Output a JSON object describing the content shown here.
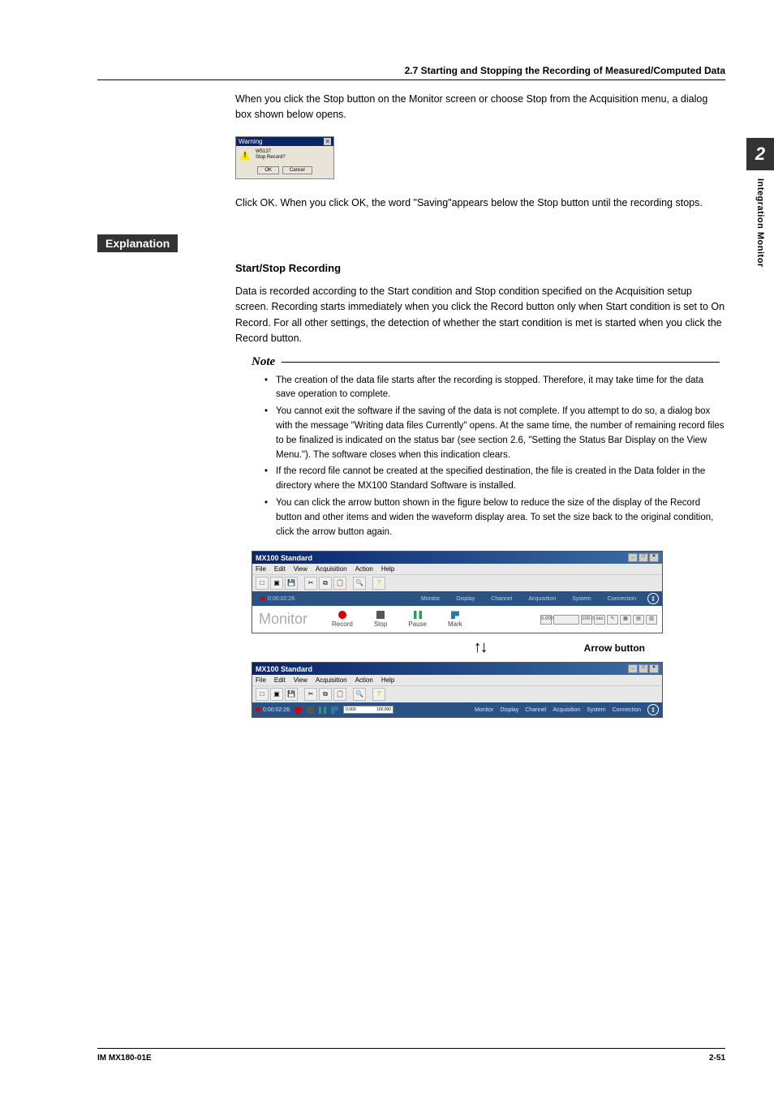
{
  "section_header": "2.7  Starting and Stopping the Recording of Measured/Computed Data",
  "intro_paragraph": "When you click the Stop button on the Monitor screen or choose Stop from the Acquisition menu, a dialog box shown below opens.",
  "warning_dialog": {
    "title": "Warning",
    "code": "W5137",
    "message": "Stop Record?",
    "ok": "OK",
    "cancel": "Cancel"
  },
  "after_dialog": "Click OK. When you click OK, the word \"Saving\"appears below the Stop button until the recording stops.",
  "explanation_label": "Explanation",
  "subheading": "Start/Stop Recording",
  "start_stop_body": "Data is recorded according to the Start condition and Stop condition specified on the Acquisition setup screen. Recording starts immediately when you click the Record button only when Start condition is set to On Record. For all other settings, the detection of whether the start condition is met is started when you click the Record button.",
  "note_label": "Note",
  "notes": [
    "The creation of the data file starts after the recording is stopped. Therefore, it may take time for the data save operation to complete.",
    "You cannot exit the software if the saving of the data is not complete. If you attempt to do so, a dialog box with the message \"Writing data files Currently\" opens. At the same time, the number of remaining record files to be finalized is indicated on the status bar (see section 2.6, \"Setting the Status Bar Display on the View Menu.\"). The software closes when this indication clears.",
    "If the record file cannot be created at the specified destination, the file is created in the Data folder in the directory where the MX100 Standard Software is installed.",
    "You can click the arrow button shown in the figure below to reduce the size of the display of the Record button and other items and widen the waveform display area. To set the size back to the original condition, click the arrow button again."
  ],
  "app": {
    "title": "MX100 Standard",
    "menus": [
      "File",
      "Edit",
      "View",
      "Acquisition",
      "Action",
      "Help"
    ],
    "timer": "0:00:02:26",
    "tabs_right": [
      "Monitor",
      "Display",
      "Channel",
      "Acquisition",
      "System",
      "Connection"
    ],
    "monitor_label": "Monitor",
    "controls": {
      "record": "Record",
      "stop": "Stop",
      "pause": "Pause",
      "mark": "Mark"
    },
    "scale_min": "0.000",
    "scale_max": "100.000",
    "scale_unit": "sec"
  },
  "arrow_label": "Arrow button",
  "side": {
    "chapter": "2",
    "label": "Integration Monitor"
  },
  "footer": {
    "left": "IM MX180-01E",
    "right": "2-51"
  }
}
